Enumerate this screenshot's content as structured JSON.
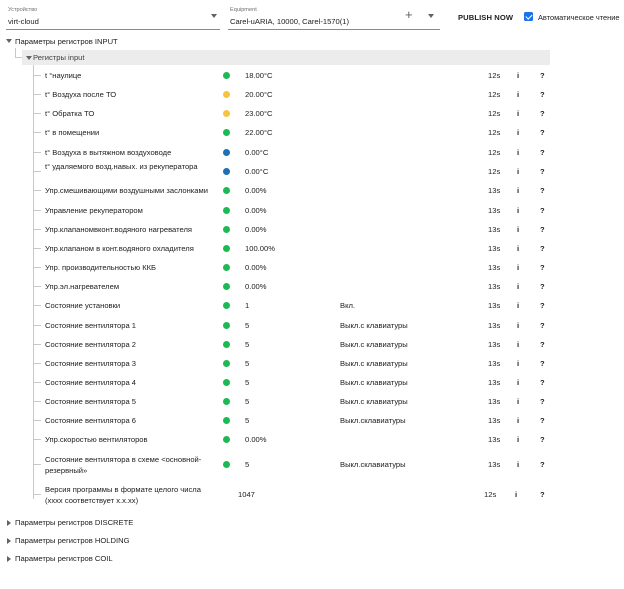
{
  "toolbar": {
    "device_label": "Устройство",
    "device_value": "virt-cloud",
    "equipment_label": "Equipment",
    "equipment_value": "Carel-uARIA, 10000, Carel-1570(1)",
    "add_symbol": "+",
    "publish_label": "PUBLISH NOW",
    "auto_read_label": "Автоматическое чтение",
    "auto_read_checked": true
  },
  "tree": {
    "input_section": "Параметры регистров INPUT",
    "input_subgroup": "Регистры input",
    "collapsed_sections": [
      "Параметры регистров DISCRETE",
      "Параметры регистров HOLDING",
      "Параметры регистров COIL"
    ]
  },
  "colors": {
    "ok": "#1db954",
    "warn": "#f5c542",
    "info": "#1f6fb5",
    "accent": "#1a73e8"
  },
  "registers": [
    {
      "name": "t °наулице",
      "status": "ok",
      "value": "18.00°C",
      "desc": "",
      "age": "12s"
    },
    {
      "name": "t° Воздуха после ТО",
      "status": "warn",
      "value": "20.00°C",
      "desc": "",
      "age": "12s"
    },
    {
      "name": "t° Обратка ТО",
      "status": "warn",
      "value": "23.00°C",
      "desc": "",
      "age": "12s"
    },
    {
      "name": "t° в помещении",
      "status": "ok",
      "value": "22.00°C",
      "desc": "",
      "age": "12s"
    },
    {
      "name": "t° Воздуха в вытяжном воздуховоде",
      "status": "info",
      "value": "0.00°C",
      "desc": "",
      "age": "12s"
    },
    {
      "name": "t° удаляемого возд.навых. из рекуператора",
      "status": "info",
      "value": "0.00°C",
      "desc": "",
      "age": "12s"
    },
    {
      "name": "Упр.смешивающими воздушными заслонками",
      "status": "ok",
      "value": "0.00%",
      "desc": "",
      "age": "13s"
    },
    {
      "name": "Управление рекуператором",
      "status": "ok",
      "value": "0.00%",
      "desc": "",
      "age": "13s"
    },
    {
      "name": "Упр.клапаномвконт.водяного нагревателя",
      "status": "ok",
      "value": "0.00%",
      "desc": "",
      "age": "13s"
    },
    {
      "name": "Упр.клапаном в конт.водяного охладителя",
      "status": "ok",
      "value": "100.00%",
      "desc": "",
      "age": "13s"
    },
    {
      "name": "Упр. производительностью ККБ",
      "status": "ok",
      "value": "0.00%",
      "desc": "",
      "age": "13s"
    },
    {
      "name": "Упр.эл.нагревателем",
      "status": "ok",
      "value": "0.00%",
      "desc": "",
      "age": "13s"
    },
    {
      "name": "Состояние установки",
      "status": "ok",
      "value": "1",
      "desc": "Вкл.",
      "age": "13s"
    },
    {
      "name": "Состояние вентилятора 1",
      "status": "ok",
      "value": "5",
      "desc": "Выкл.с клавиатуры",
      "age": "13s"
    },
    {
      "name": "Состояние вентилятора 2",
      "status": "ok",
      "value": "5",
      "desc": "Выкл.с клавиатуры",
      "age": "13s"
    },
    {
      "name": "Состояние вентилятора 3",
      "status": "ok",
      "value": "5",
      "desc": "Выкл.с клавиатуры",
      "age": "13s"
    },
    {
      "name": "Состояние вентилятора 4",
      "status": "ok",
      "value": "5",
      "desc": "Выкл.с клавиатуры",
      "age": "13s"
    },
    {
      "name": "Состояние вентилятора 5",
      "status": "ok",
      "value": "5",
      "desc": "Выкл.с клавиатуры",
      "age": "13s"
    },
    {
      "name": "Состояние вентилятора 6",
      "status": "ok",
      "value": "5",
      "desc": "Выкл.склавиатуры",
      "age": "13s"
    },
    {
      "name": "Упр.скоростью вентиляторов",
      "status": "ok",
      "value": "0.00%",
      "desc": "",
      "age": "13s"
    },
    {
      "name": "Состояние вентилятора в схеме <основной-резервный»",
      "status": "ok",
      "value": "5",
      "desc": "Выкл.склавиатуры",
      "age": "13s"
    },
    {
      "name": "Версия программы в формате целого числа (хххх соответствует х.х.хх)",
      "status": "",
      "value": "1047",
      "desc": "",
      "age": "12s"
    }
  ],
  "row_actions": {
    "info": "i",
    "help": "?"
  }
}
